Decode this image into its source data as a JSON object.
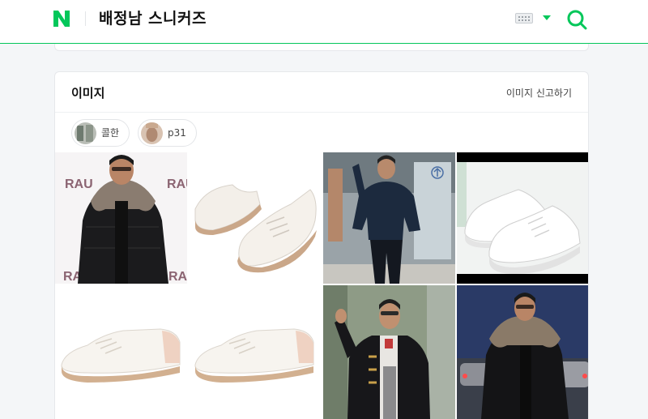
{
  "header": {
    "query": "배정남 스니커즈"
  },
  "image_section": {
    "title": "이미지",
    "report_label": "이미지 신고하기",
    "chips": [
      {
        "label": "콜한"
      },
      {
        "label": "p31"
      }
    ],
    "banner_text": "RAU"
  },
  "colors": {
    "brand_green": "#03c75a"
  }
}
